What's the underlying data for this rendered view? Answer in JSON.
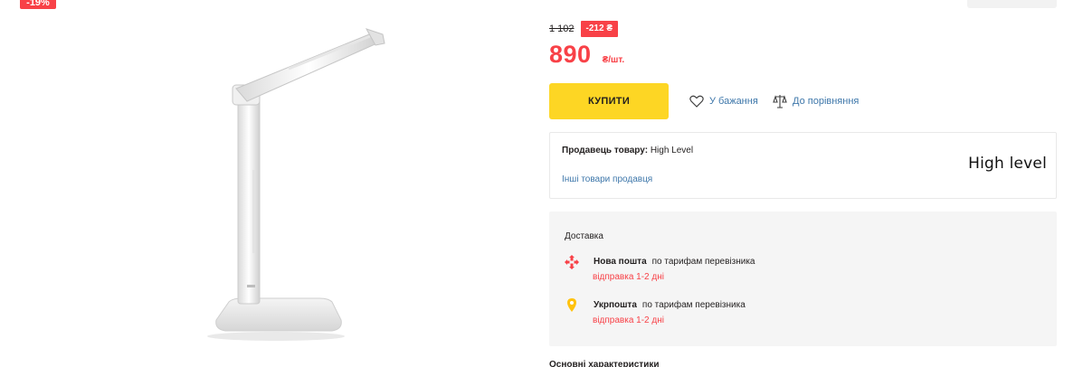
{
  "badge": {
    "discount": "-19%"
  },
  "price": {
    "old": "1 102",
    "diff": "-212 ₴",
    "current": "890",
    "unit": "₴/шт."
  },
  "actions": {
    "buy_label": "КУПИТИ",
    "wishlist_label": "У бажання",
    "compare_label": "До порівняння"
  },
  "seller": {
    "prefix": "Продавець товару:",
    "name": "High Level",
    "other_link": "Інші товари продавця",
    "logo_text": "High level"
  },
  "delivery": {
    "title": "Доставка",
    "carriers": [
      {
        "name": "Нова пошта",
        "rate": "по тарифам перевізника",
        "eta": "відправка 1-2 дні",
        "icon": "nova-poshta-icon"
      },
      {
        "name": "Укрпошта",
        "rate": "по тарифам перевізника",
        "eta": "відправка 1-2 дні",
        "icon": "ukrposhta-icon"
      }
    ]
  },
  "next_section": {
    "title": "Основні характеристики"
  },
  "colors": {
    "accent_red": "#f84147",
    "buy_yellow": "#fdd624",
    "link_blue": "#3e77aa"
  }
}
